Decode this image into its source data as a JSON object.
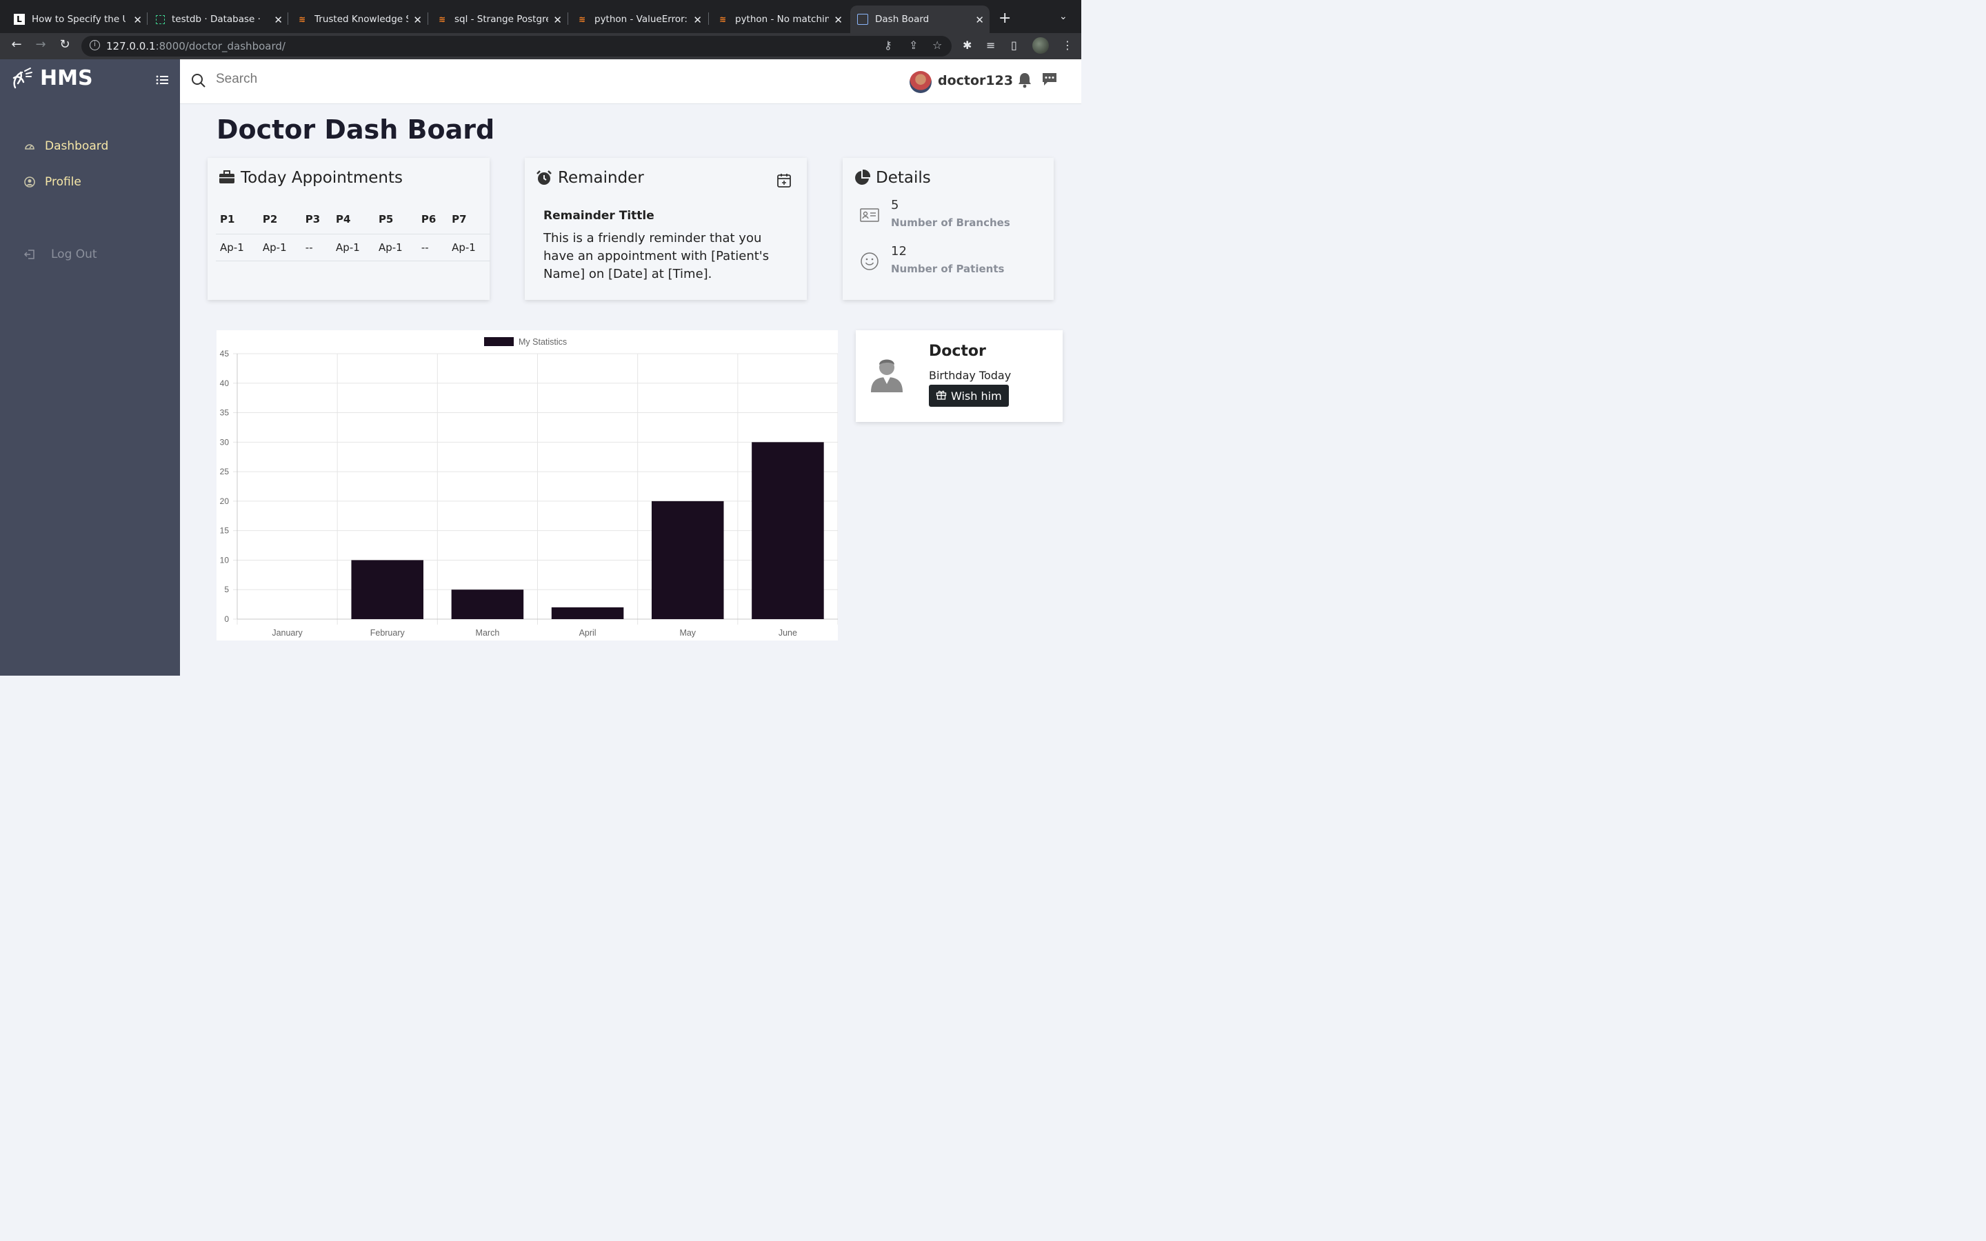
{
  "browser": {
    "tabs": [
      {
        "title": "How to Specify the UI",
        "icon": "L"
      },
      {
        "title": "testdb · Database ·",
        "icon": "db"
      },
      {
        "title": "Trusted Knowledge Sh",
        "icon": "so"
      },
      {
        "title": "sql - Strange Postgre",
        "icon": "so"
      },
      {
        "title": "python - ValueError: In",
        "icon": "so"
      },
      {
        "title": "python - No matching",
        "icon": "so"
      },
      {
        "title": "Dash Board",
        "icon": "page"
      }
    ],
    "url_host": "127.0.0.1",
    "url_path": ":8000/doctor_dashboard/"
  },
  "sidebar": {
    "logo": "HMS",
    "items": [
      {
        "label": "Dashboard"
      },
      {
        "label": "Profile"
      }
    ],
    "logout": "Log Out"
  },
  "topbar": {
    "search_placeholder": "Search",
    "username": "doctor123"
  },
  "page": {
    "title": "Doctor Dash Board"
  },
  "appointments": {
    "title": "Today Appointments",
    "headers": [
      "P1",
      "P2",
      "P3",
      "P4",
      "P5",
      "P6",
      "P7"
    ],
    "row": [
      "Ap-1",
      "Ap-1",
      "--",
      "Ap-1",
      "Ap-1",
      "--",
      "Ap-1"
    ]
  },
  "reminder": {
    "title": "Remainder",
    "heading": "Remainder Tittle",
    "body": "This is a friendly reminder that you have an appointment with [Patient's Name] on [Date] at [Time]."
  },
  "details": {
    "title": "Details",
    "items": [
      {
        "value": "5",
        "label": "Number of Branches",
        "icon": "id-card-icon"
      },
      {
        "value": "12",
        "label": "Number of Patients",
        "icon": "smile-icon"
      }
    ]
  },
  "birthday": {
    "name": "Doctor",
    "text": "Birthday Today",
    "button": "Wish him"
  },
  "chart_data": {
    "type": "bar",
    "categories": [
      "January",
      "February",
      "March",
      "April",
      "May",
      "June"
    ],
    "series": [
      {
        "name": "My Statistics",
        "values": [
          0,
          10,
          5,
          2,
          20,
          30
        ]
      }
    ],
    "ylim": [
      0,
      45
    ],
    "yticks": [
      0,
      5,
      10,
      15,
      20,
      25,
      30,
      35,
      40,
      45
    ],
    "bar_color": "#1a0d1f",
    "grid": true,
    "legend": "top"
  }
}
